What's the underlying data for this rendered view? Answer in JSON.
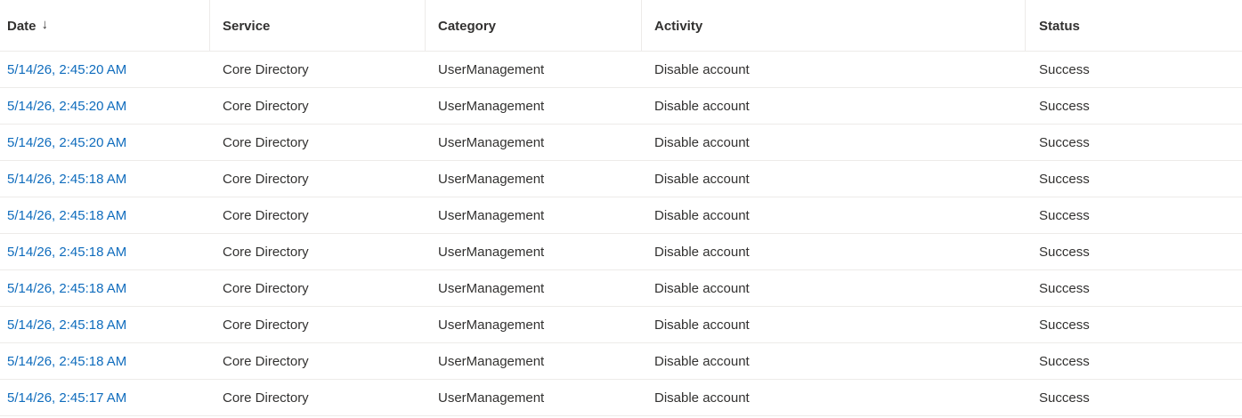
{
  "columns": [
    {
      "label": "Date",
      "sort": "descending"
    },
    {
      "label": "Service"
    },
    {
      "label": "Category"
    },
    {
      "label": "Activity"
    },
    {
      "label": "Status"
    }
  ],
  "sort_icon": "arrow-down-icon",
  "sort_glyph": "↓",
  "colors": {
    "link": "#0f6cbd",
    "text": "#323130",
    "divider": "#edebe9"
  },
  "rows": [
    {
      "date": "5/14/26, 2:45:20 AM",
      "service": "Core Directory",
      "category": "UserManagement",
      "activity": "Disable account",
      "status": "Success"
    },
    {
      "date": "5/14/26, 2:45:20 AM",
      "service": "Core Directory",
      "category": "UserManagement",
      "activity": "Disable account",
      "status": "Success"
    },
    {
      "date": "5/14/26, 2:45:20 AM",
      "service": "Core Directory",
      "category": "UserManagement",
      "activity": "Disable account",
      "status": "Success"
    },
    {
      "date": "5/14/26, 2:45:18 AM",
      "service": "Core Directory",
      "category": "UserManagement",
      "activity": "Disable account",
      "status": "Success"
    },
    {
      "date": "5/14/26, 2:45:18 AM",
      "service": "Core Directory",
      "category": "UserManagement",
      "activity": "Disable account",
      "status": "Success"
    },
    {
      "date": "5/14/26, 2:45:18 AM",
      "service": "Core Directory",
      "category": "UserManagement",
      "activity": "Disable account",
      "status": "Success"
    },
    {
      "date": "5/14/26, 2:45:18 AM",
      "service": "Core Directory",
      "category": "UserManagement",
      "activity": "Disable account",
      "status": "Success"
    },
    {
      "date": "5/14/26, 2:45:18 AM",
      "service": "Core Directory",
      "category": "UserManagement",
      "activity": "Disable account",
      "status": "Success"
    },
    {
      "date": "5/14/26, 2:45:18 AM",
      "service": "Core Directory",
      "category": "UserManagement",
      "activity": "Disable account",
      "status": "Success"
    },
    {
      "date": "5/14/26, 2:45:17 AM",
      "service": "Core Directory",
      "category": "UserManagement",
      "activity": "Disable account",
      "status": "Success"
    }
  ]
}
